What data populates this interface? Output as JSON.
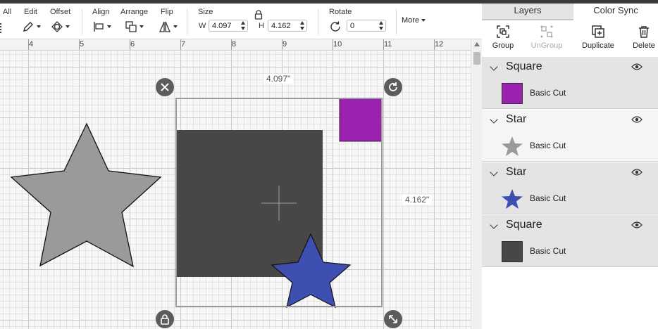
{
  "toolbar": {
    "select_all_label": "All",
    "edit_label": "Edit",
    "offset_label": "Offset",
    "align_label": "Align",
    "arrange_label": "Arrange",
    "flip_label": "Flip",
    "size_label": "Size",
    "width_prefix": "W",
    "width_value": "4.097",
    "height_prefix": "H",
    "height_value": "4.162",
    "rotate_label": "Rotate",
    "rotate_value": "0",
    "more_label": "More"
  },
  "ruler": {
    "marks": [
      "4",
      "5",
      "6",
      "7",
      "8",
      "9",
      "10",
      "11",
      "12"
    ]
  },
  "canvas": {
    "width_dimension": "4.097\"",
    "height_dimension": "4.162\"",
    "colors": {
      "gray_star": "#9a9a9a",
      "dark_square": "#474747",
      "purple_square": "#9b22b0",
      "blue_star": "#3e4fb2"
    }
  },
  "panel": {
    "tabs": [
      "Layers",
      "Color Sync"
    ],
    "actions": {
      "group": "Group",
      "ungroup": "UnGroup",
      "duplicate": "Duplicate",
      "delete": "Delete"
    },
    "layers": [
      {
        "name": "Square",
        "operation": "Basic Cut",
        "color": "#9b22b0"
      },
      {
        "name": "Star",
        "operation": "Basic Cut",
        "color": "#9a9a9a"
      },
      {
        "name": "Star",
        "operation": "Basic Cut",
        "color": "#3e4fb2"
      },
      {
        "name": "Square",
        "operation": "Basic Cut",
        "color": "#474747"
      }
    ]
  }
}
